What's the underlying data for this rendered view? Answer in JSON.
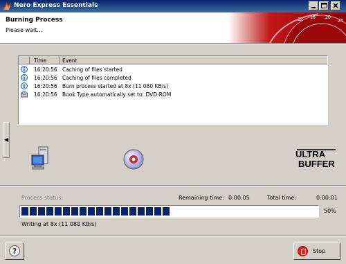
{
  "window": {
    "title": "Nero Express Essentials"
  },
  "header": {
    "title": "Burning Process",
    "subtitle": "Please wait..."
  },
  "log": {
    "columns": {
      "time": "Time",
      "event": "Event"
    },
    "rows": [
      {
        "icon": "info-icon",
        "time": "16:20:56",
        "event": "Caching of files started"
      },
      {
        "icon": "info-icon",
        "time": "16:20:56",
        "event": "Caching of files completed"
      },
      {
        "icon": "info-icon",
        "time": "16:20:56",
        "event": "Burn process started at 8x (11 080 KB/s)"
      },
      {
        "icon": "disc-drive-icon",
        "time": "16:20:56",
        "event": "Book Type automatically set to: DVD-ROM"
      }
    ]
  },
  "status": {
    "process_label": "Process status:",
    "remaining_label": "Remaining time:",
    "remaining_value": "0:00:05",
    "total_label": "Total time:",
    "total_value": "0:00:01",
    "progress_percent": 50,
    "progress_text": "50%",
    "writing_text": "Writing at 8x (11 080 KB/s)",
    "bar_color": "#0a246a"
  },
  "buttons": {
    "stop_label": "Stop",
    "help_label": "?"
  },
  "side_tab": {
    "glyph": "◀"
  }
}
